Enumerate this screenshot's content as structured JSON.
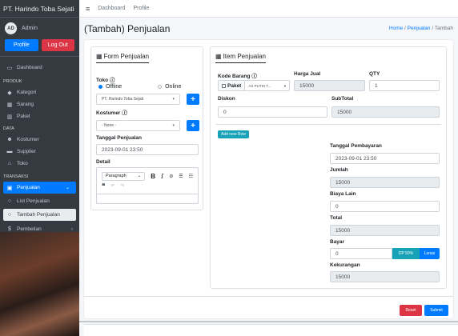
{
  "sidebar": {
    "brand": "PT. Harindo Toba Sejati",
    "user": {
      "initials": "AD",
      "name": "Admin"
    },
    "profile_label": "Profile",
    "logout_label": "Log Out",
    "dashboard": "Dashboard",
    "sections": {
      "produk": "PRODUK",
      "data": "DATA",
      "transaksi": "TRANSAKSI"
    },
    "produk_items": [
      "Kategori",
      "Sarang",
      "Paket"
    ],
    "data_items": [
      "Kostumer",
      "Supplier",
      "Toko"
    ],
    "penjualan": "Penjualan",
    "list_penjualan": "List Penjualan",
    "tambah_penjualan": "Tambah Penjualan",
    "pembelian": "Pembelian"
  },
  "topbar": {
    "dashboard": "Dashboard",
    "profile": "Profile"
  },
  "page": {
    "title": "(Tambah) Penjualan",
    "breadcrumb": {
      "home": "Home",
      "sep1": "/",
      "penjualan": "Penjualan",
      "sep2": "/",
      "current": "Tambah"
    }
  },
  "form": {
    "title": "Form Penjualan",
    "toko_label": "Toko",
    "offline": "Offline",
    "online": "Online",
    "toko_select": "PT. Harindo Toba Sejati",
    "kostumer_label": "Kostumer",
    "kostumer_select": "- None -",
    "tanggal_label": "Tanggal Penjualan",
    "tanggal_value": "2023-09-01 23:50",
    "detail_label": "Detail",
    "editor_paragraph": "Paragraph"
  },
  "items": {
    "title": "Item Penjualan",
    "kode_label": "Kode Barang",
    "harga_label": "Harga Jual",
    "qty_label": "QTY",
    "paket_label": "Paket",
    "kode_select": "AS PUTIH T...",
    "harga_value": "15000",
    "qty_value": "1",
    "diskon_label": "Diskon",
    "diskon_value": "0",
    "subtotal_label": "SubTotal",
    "subtotal_value": "15000",
    "add_row": "Add new Row"
  },
  "payment": {
    "tanggal_label": "Tanggal Pembayaran",
    "tanggal_value": "2023-09-01 23:50",
    "jumlah_label": "Jumlah",
    "jumlah_value": "15000",
    "biaya_label": "Biaya Lain",
    "biaya_value": "0",
    "total_label": "Total",
    "total_value": "15000",
    "bayar_label": "Bayar",
    "bayar_value": "0",
    "dp_label": "DP 50%",
    "lunas_label": "Lunas",
    "kekurangan_label": "Kekurangan",
    "kekurangan_value": "15000"
  },
  "actions": {
    "reset": "Reset",
    "submit": "Submit"
  },
  "colors": {
    "primary": "#007bff",
    "danger": "#dc3545",
    "info": "#17a2b8",
    "sidebar": "#343a40"
  }
}
